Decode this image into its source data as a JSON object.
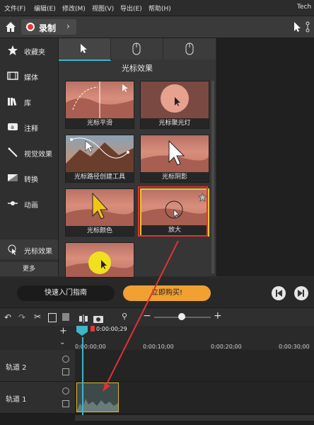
{
  "menu": {
    "items": [
      "文件(F)",
      "编辑(E)",
      "修改(M)",
      "视图(V)",
      "导出(E)",
      "帮助(H)"
    ],
    "app_title_partial": "Tech"
  },
  "toolbar": {
    "home_icon": "home-icon",
    "record_label": "录制"
  },
  "sidebar": {
    "items": [
      {
        "label": "收藏夹",
        "icon": "star-icon"
      },
      {
        "label": "媒体",
        "icon": "film-icon"
      },
      {
        "label": "库",
        "icon": "library-icon"
      },
      {
        "label": "注释",
        "icon": "annotation-icon"
      },
      {
        "label": "视觉效果",
        "icon": "magic-wand-icon"
      },
      {
        "label": "转换",
        "icon": "transition-icon"
      },
      {
        "label": "动画",
        "icon": "animation-icon"
      },
      {
        "label": "光标效果",
        "icon": "cursor-effect-icon"
      }
    ],
    "more_label": "更多"
  },
  "panel": {
    "title": "光标效果",
    "tabs": [
      "cursor-arrow-icon",
      "mouse-left-icon",
      "mouse-right-icon"
    ],
    "effects": [
      {
        "label": "光标平滑"
      },
      {
        "label": "光标聚光灯"
      },
      {
        "label": "光标路径创建工具"
      },
      {
        "label": "光标阴影"
      },
      {
        "label": "光标颜色"
      },
      {
        "label": "放大"
      },
      {
        "label": ""
      }
    ]
  },
  "bottom_bar": {
    "guide_label": "快速入门指南",
    "buy_label": "立即购买!"
  },
  "timeline": {
    "playhead_time": "0:00:00;29",
    "ruler": [
      "0:00:00;00",
      "0:00:10;00",
      "0:00:20;00",
      "0:00:30;00"
    ],
    "tracks": [
      {
        "label": "轨道 2"
      },
      {
        "label": "轨道 1"
      }
    ]
  },
  "colors": {
    "accent": "#3fb5c9",
    "buy_button": "#f0a132",
    "highlight_box": "#e03232",
    "selected_border": "#f2c230",
    "record_red": "#e53935"
  }
}
